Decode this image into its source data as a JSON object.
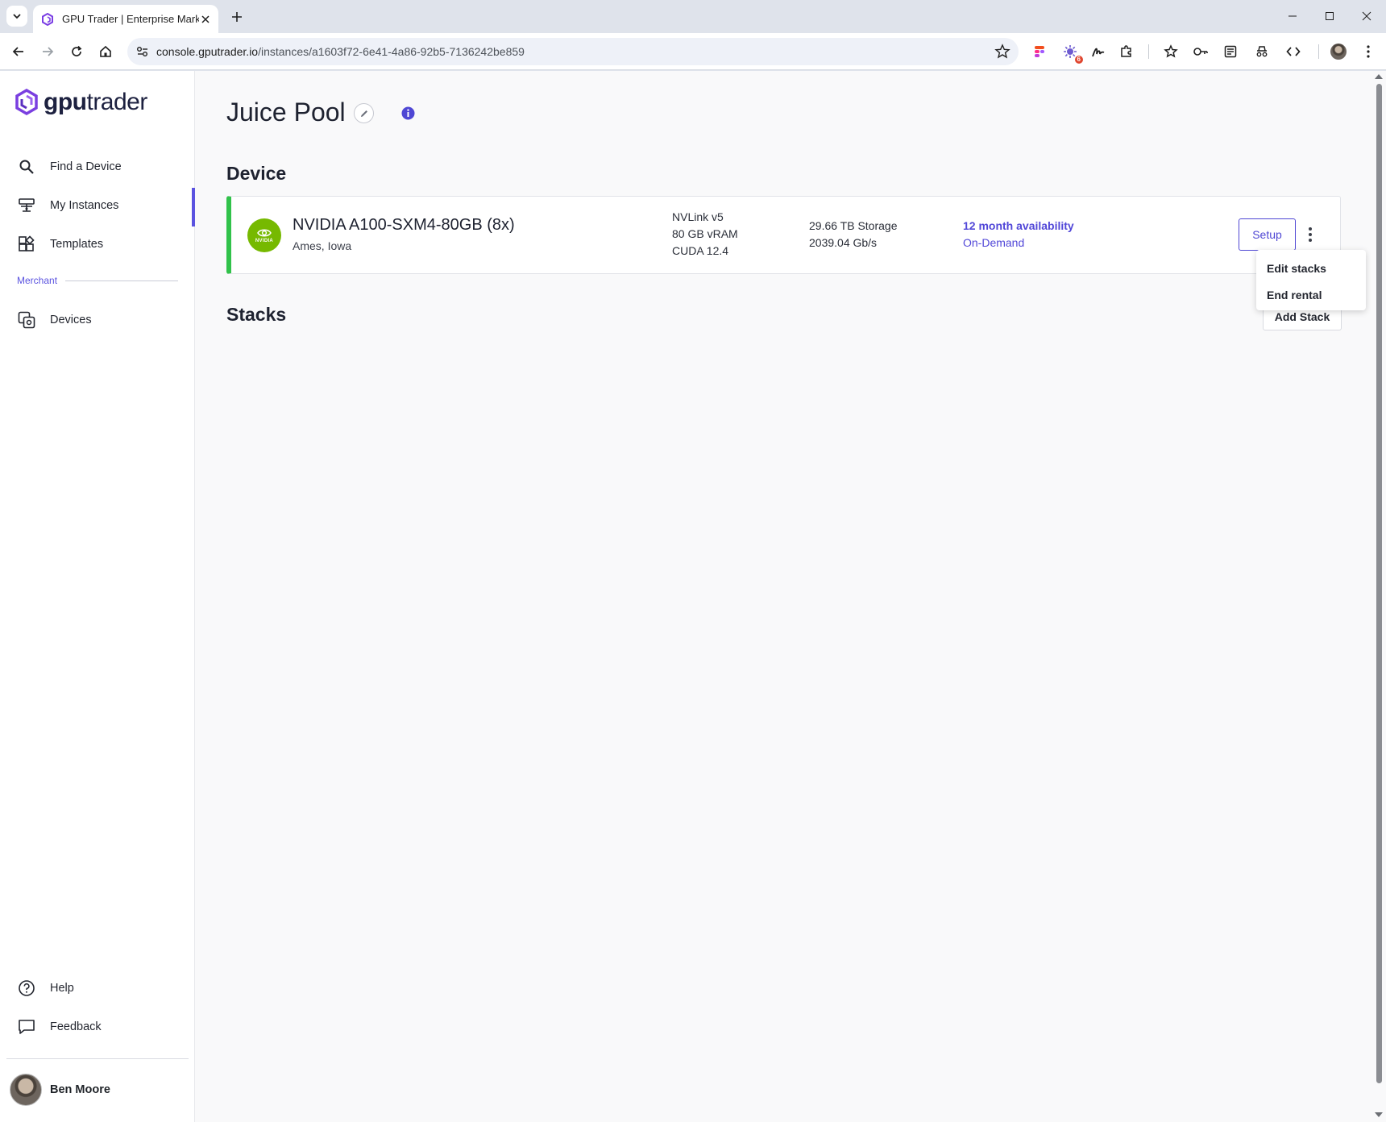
{
  "browser": {
    "tab_title": "GPU Trader | Enterprise Marketp",
    "url_host": "console.gputrader.io",
    "url_path": "/instances/a1603f72-6e41-4a86-92b5-7136242be859",
    "extension_badge": "6"
  },
  "logo": {
    "bold": "gpu",
    "rest": "trader"
  },
  "sidebar": {
    "items": [
      {
        "label": "Find a Device",
        "icon": "search-icon"
      },
      {
        "label": "My Instances",
        "icon": "instances-icon",
        "active": true
      },
      {
        "label": "Templates",
        "icon": "templates-icon"
      }
    ],
    "section_label": "Merchant",
    "merchant_items": [
      {
        "label": "Devices",
        "icon": "devices-icon"
      }
    ],
    "bottom_items": [
      {
        "label": "Help",
        "icon": "help-icon"
      },
      {
        "label": "Feedback",
        "icon": "feedback-icon"
      }
    ],
    "user_name": "Ben Moore"
  },
  "page": {
    "title": "Juice Pool",
    "device_section": "Device",
    "stacks_section": "Stacks",
    "add_stack_label": "Add Stack"
  },
  "device": {
    "logo_text": "NVIDIA",
    "name": "NVIDIA A100-SXM4-80GB (8x)",
    "location": "Ames, Iowa",
    "specs1": [
      "NVLink v5",
      "80 GB vRAM",
      "CUDA 12.4"
    ],
    "specs2": [
      "29.66 TB Storage",
      "2039.04 Gb/s"
    ],
    "availability": "12 month availability",
    "pricing": "On-Demand",
    "setup_label": "Setup",
    "status_color": "#31c24a"
  },
  "menu": {
    "items": [
      "Edit stacks",
      "End rental"
    ]
  },
  "colors": {
    "accent": "#5b53e0",
    "nvidia": "#76b900"
  }
}
